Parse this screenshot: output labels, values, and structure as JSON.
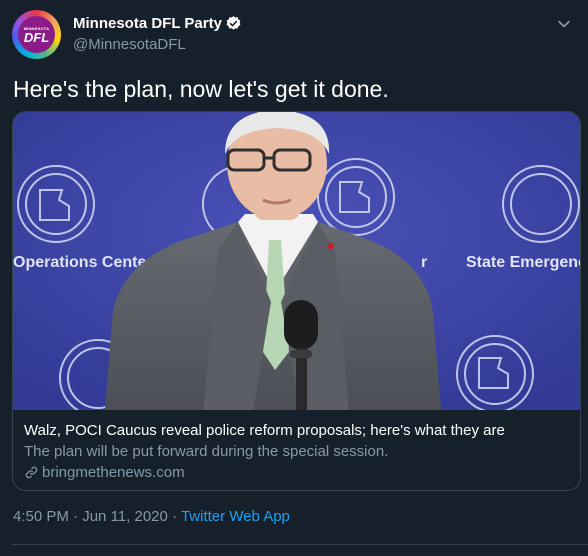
{
  "author": {
    "display_name": "Minnesota DFL Party",
    "handle": "@MinnesotaDFL",
    "avatar_small": "MINNESOTA",
    "avatar_text": "DFL",
    "verified": true
  },
  "tweet": {
    "text": "Here's the plan, now let's get it done."
  },
  "card": {
    "title": "Walz, POCI Caucus reveal police reform proposals; here's what they are",
    "description": "The plan will be put forward during the special session.",
    "domain": "bringmethenews.com",
    "media": {
      "left_sign": "Operations Center",
      "mid_sign": "r",
      "right_sign": "State Emergenc"
    }
  },
  "meta": {
    "time": "4:50 PM",
    "separator1": "·",
    "date": "Jun 11, 2020",
    "separator2": "·",
    "source": "Twitter Web App"
  },
  "colors": {
    "background": "#15202b",
    "secondary_text": "#8899a6",
    "accent": "#1da1f2",
    "border": "#38444d"
  }
}
